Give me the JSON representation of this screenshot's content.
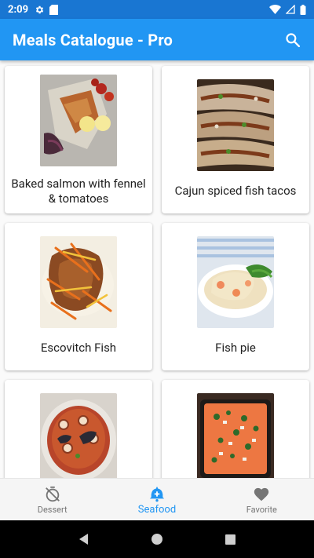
{
  "status_bar": {
    "time": "2:09"
  },
  "app_bar": {
    "title": "Meals Catalogue - Pro"
  },
  "meals": [
    {
      "name": "Baked salmon with fennel & tomatoes"
    },
    {
      "name": "Cajun spiced fish tacos"
    },
    {
      "name": "Escovitch Fish"
    },
    {
      "name": "Fish pie"
    },
    {
      "name": ""
    },
    {
      "name": ""
    }
  ],
  "bottom_nav": {
    "items": [
      {
        "label": "Dessert",
        "icon": "timer-off-icon"
      },
      {
        "label": "Seafood",
        "icon": "seafood-icon",
        "active": true
      },
      {
        "label": "Favorite",
        "icon": "heart-icon"
      }
    ]
  },
  "colors": {
    "primary": "#2196f3",
    "status_bar": "#1976d2"
  }
}
